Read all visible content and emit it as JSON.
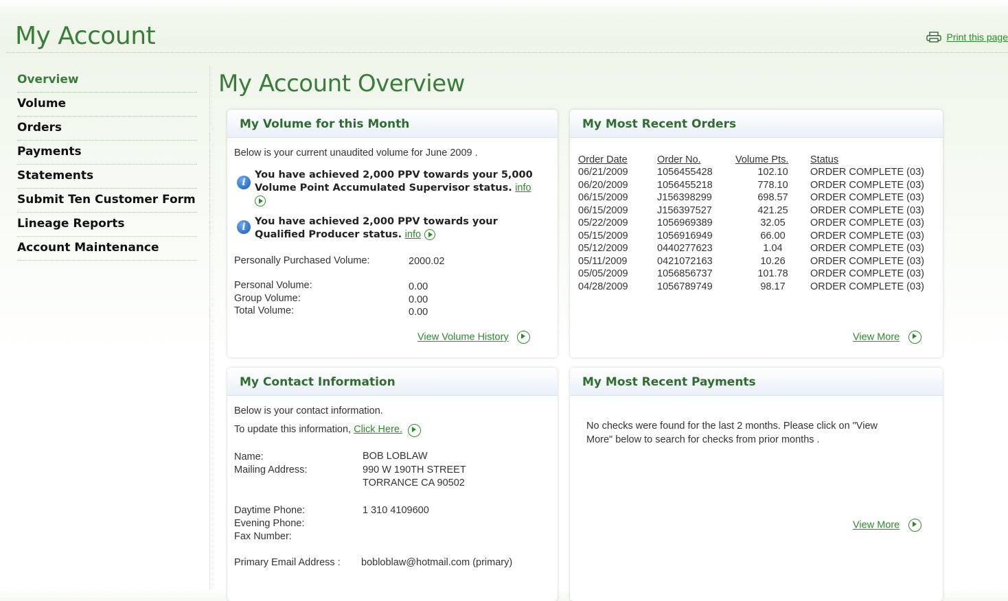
{
  "header": {
    "title": "My Account",
    "print_label": "Print this page"
  },
  "sidebar": {
    "items": [
      {
        "label": "Overview"
      },
      {
        "label": "Volume"
      },
      {
        "label": "Orders"
      },
      {
        "label": "Payments"
      },
      {
        "label": "Statements"
      },
      {
        "label": "Submit Ten Customer Form"
      },
      {
        "label": "Lineage Reports"
      },
      {
        "label": "Account Maintenance"
      }
    ]
  },
  "main": {
    "title": "My Account Overview"
  },
  "volume_panel": {
    "title": "My Volume for this Month",
    "intro": "Below is your current unaudited volume for June 2009 .",
    "msg1": "You have achieved 2,000 PPV towards your 5,000 Volume Point Accumulated Supervisor status.",
    "msg2": "You have achieved 2,000 PPV towards your Qualified Producer status.",
    "info_label": "info",
    "ppv_label": "Personally Purchased Volume:",
    "ppv_value": "2000.02",
    "personal_label": "Personal Volume:",
    "personal_value": "0.00",
    "group_label": "Group Volume:",
    "group_value": "0.00",
    "total_label": "Total Volume:",
    "total_value": "0.00",
    "history_link": "View Volume History"
  },
  "orders_panel": {
    "title": "My Most Recent Orders",
    "columns": [
      "Order Date",
      "Order No.",
      "Volume Pts.",
      "Status"
    ],
    "rows": [
      [
        "06/21/2009",
        "1056455428",
        "102.10",
        "ORDER COMPLETE (03)"
      ],
      [
        "06/20/2009",
        "1056455218",
        "778.10",
        "ORDER COMPLETE (03)"
      ],
      [
        "06/15/2009",
        "J156398299",
        "698.57",
        "ORDER COMPLETE (03)"
      ],
      [
        "06/15/2009",
        "J156397527",
        "421.25",
        "ORDER COMPLETE (03)"
      ],
      [
        "05/22/2009",
        "1056969389",
        "32.05",
        "ORDER COMPLETE (03)"
      ],
      [
        "05/15/2009",
        "1056916949",
        "66.00",
        "ORDER COMPLETE (03)"
      ],
      [
        "05/12/2009",
        "0440277623",
        "1.04",
        "ORDER COMPLETE (03)"
      ],
      [
        "05/11/2009",
        "0421072163",
        "10.26",
        "ORDER COMPLETE (03)"
      ],
      [
        "05/05/2009",
        "1056856737",
        "101.78",
        "ORDER COMPLETE (03)"
      ],
      [
        "04/28/2009",
        "1056789749",
        "98.17",
        "ORDER COMPLETE (03)"
      ]
    ],
    "view_more": "View More"
  },
  "contact_panel": {
    "title": "My Contact Information",
    "intro": "Below is your contact information.",
    "update_text": "To update this information,",
    "update_link": "Click Here.",
    "name_label": "Name:",
    "name_value": "BOB LOBLAW",
    "address_label": "Mailing Address:",
    "address_line1": "990 W 190TH STREET",
    "address_line2": "TORRANCE CA 90502",
    "daytime_label": "Daytime Phone:",
    "daytime_value": "1 310 4109600",
    "evening_label": "Evening Phone:",
    "fax_label": "Fax Number:",
    "email_label": "Primary Email Address :",
    "email_value": "bobloblaw@hotmail.com (primary)"
  },
  "payments_panel": {
    "title": "My Most Recent  Payments",
    "message": "No checks were found for the last 2 months. Please click on \"View More\" below to search for checks from prior months .",
    "view_more": "View More"
  }
}
